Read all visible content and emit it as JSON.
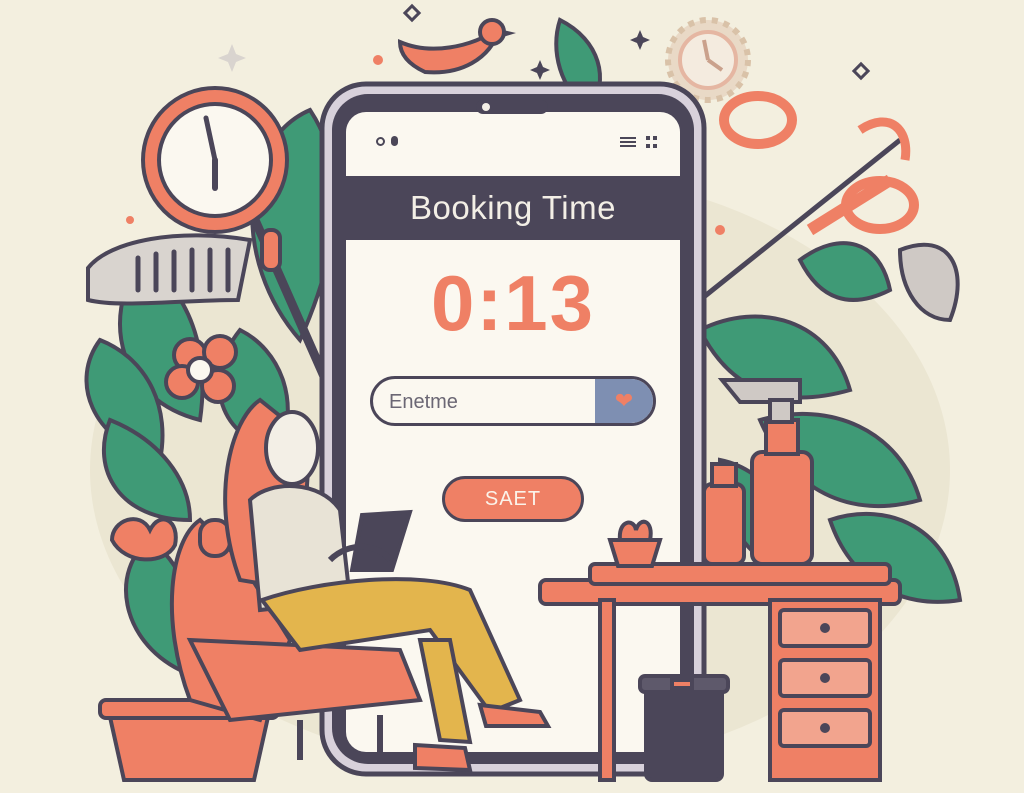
{
  "app": {
    "header_title": "Booking Time",
    "timer": "0:13",
    "name_input": {
      "placeholder": "Enetme",
      "value": ""
    },
    "save_label": "SAET"
  },
  "icons": {
    "status_left": [
      "circle-dot-icon",
      "pill-icon"
    ],
    "status_right": [
      "menu-icon",
      "grid-icon"
    ],
    "input_action": "heart-icon"
  },
  "colors": {
    "background": "#f3efdf",
    "accent_coral": "#ef8065",
    "dark_purple": "#4b4659",
    "leaf_green": "#3f9a76",
    "mustard": "#e3b54d",
    "slate_blue": "#7e8fb2"
  }
}
